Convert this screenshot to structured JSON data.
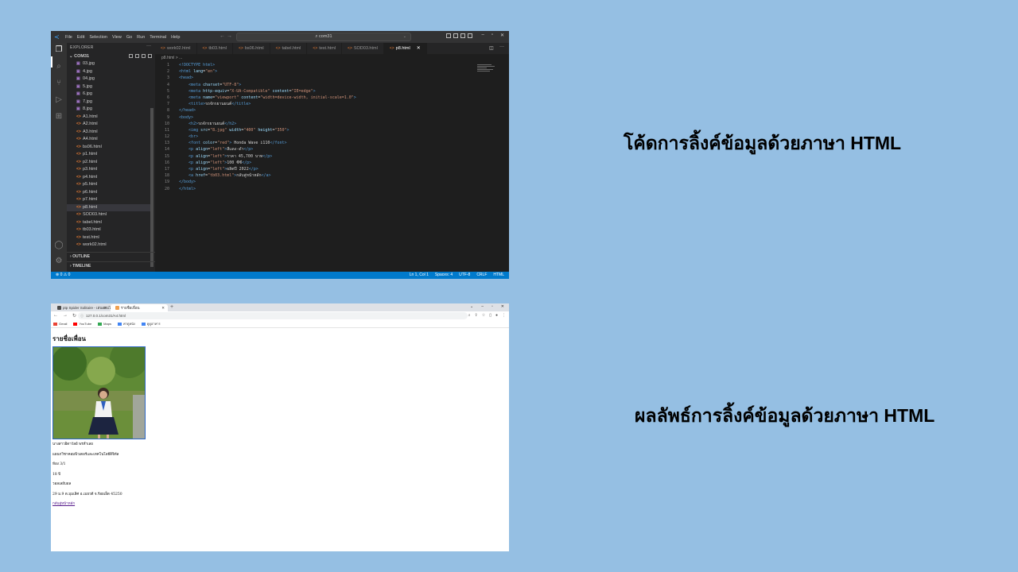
{
  "captions": {
    "code": "โค้ดการลิ้งค์ข้อมูลด้วยภาษา HTML",
    "result": "ผลลัพธ์การลิ้งค์ข้อมูลด้วยภาษา HTML"
  },
  "vscode": {
    "menu": [
      "File",
      "Edit",
      "Selection",
      "View",
      "Go",
      "Run",
      "Terminal",
      "Help"
    ],
    "search_text": "com31",
    "explorer_title": "EXPLORER",
    "folder_name": "COM31",
    "files": [
      {
        "name": "03.jpg",
        "type": "img"
      },
      {
        "name": "4.jpg",
        "type": "img"
      },
      {
        "name": "04.jpg",
        "type": "img"
      },
      {
        "name": "5.jpg",
        "type": "img"
      },
      {
        "name": "6.jpg",
        "type": "img"
      },
      {
        "name": "7.jpg",
        "type": "img"
      },
      {
        "name": "8.jpg",
        "type": "img"
      },
      {
        "name": "A1.html",
        "type": "html"
      },
      {
        "name": "A2.html",
        "type": "html"
      },
      {
        "name": "A3.html",
        "type": "html"
      },
      {
        "name": "A4.html",
        "type": "html"
      },
      {
        "name": "bs06.html",
        "type": "html"
      },
      {
        "name": "p1.html",
        "type": "html"
      },
      {
        "name": "p2.html",
        "type": "html"
      },
      {
        "name": "p3.html",
        "type": "html"
      },
      {
        "name": "p4.html",
        "type": "html"
      },
      {
        "name": "p5.html",
        "type": "html"
      },
      {
        "name": "p6.html",
        "type": "html"
      },
      {
        "name": "p7.html",
        "type": "html"
      },
      {
        "name": "p8.html",
        "type": "html"
      },
      {
        "name": "SOD03.html",
        "type": "html"
      },
      {
        "name": "tabel.html",
        "type": "html"
      },
      {
        "name": "tb03.html",
        "type": "html"
      },
      {
        "name": "test.html",
        "type": "html"
      },
      {
        "name": "work02.html",
        "type": "html"
      }
    ],
    "selected_file": "p8.html",
    "outline_label": "OUTLINE",
    "timeline_label": "TIMELINE",
    "tabs": [
      "work02.html",
      "tb03.html",
      "bs06.html",
      "tabel.html",
      "test.html",
      "SOD03.html",
      "p8.html"
    ],
    "active_tab": "p8.html",
    "breadcrumb": "p8.html > ...",
    "code_lines": [
      [
        [
          "c-tag",
          "<!DOCTYPE html>"
        ]
      ],
      [
        [
          "c-tag",
          "<html "
        ],
        [
          "c-attr",
          "lang"
        ],
        [
          "c-txt",
          "="
        ],
        [
          "c-str",
          "\"en\""
        ],
        [
          "c-tag",
          ">"
        ]
      ],
      [
        [
          "c-tag",
          "<head>"
        ]
      ],
      [
        [
          "c-txt",
          "    "
        ],
        [
          "c-tag",
          "<meta "
        ],
        [
          "c-attr",
          "charset"
        ],
        [
          "c-txt",
          "="
        ],
        [
          "c-str",
          "\"UTF-8\""
        ],
        [
          "c-tag",
          ">"
        ]
      ],
      [
        [
          "c-txt",
          "    "
        ],
        [
          "c-tag",
          "<meta "
        ],
        [
          "c-attr",
          "http-equiv"
        ],
        [
          "c-txt",
          "="
        ],
        [
          "c-str",
          "\"X-UA-Compatible\""
        ],
        [
          "c-txt",
          " "
        ],
        [
          "c-attr",
          "content"
        ],
        [
          "c-txt",
          "="
        ],
        [
          "c-str",
          "\"IE=edge\""
        ],
        [
          "c-tag",
          ">"
        ]
      ],
      [
        [
          "c-txt",
          "    "
        ],
        [
          "c-tag",
          "<meta "
        ],
        [
          "c-attr",
          "name"
        ],
        [
          "c-txt",
          "="
        ],
        [
          "c-str",
          "\"viewport\""
        ],
        [
          "c-txt",
          " "
        ],
        [
          "c-attr",
          "content"
        ],
        [
          "c-txt",
          "="
        ],
        [
          "c-str",
          "\"width=device-width, initial-scale=1.0\""
        ],
        [
          "c-tag",
          ">"
        ]
      ],
      [
        [
          "c-txt",
          "    "
        ],
        [
          "c-tag",
          "<title>"
        ],
        [
          "c-txt",
          "รถจักรยานยนต์"
        ],
        [
          "c-tag",
          "</title>"
        ]
      ],
      [
        [
          "c-tag",
          "</head>"
        ]
      ],
      [
        [
          "c-tag",
          "<body>"
        ]
      ],
      [
        [
          "c-txt",
          "    "
        ],
        [
          "c-tag",
          "<h2>"
        ],
        [
          "c-txt",
          "รถจักรยานยนต์"
        ],
        [
          "c-tag",
          "</h2>"
        ]
      ],
      [
        [
          "c-txt",
          "    "
        ],
        [
          "c-tag",
          "<img "
        ],
        [
          "c-attr",
          "src"
        ],
        [
          "c-txt",
          "="
        ],
        [
          "c-str",
          "\"8.jpg\""
        ],
        [
          "c-txt",
          " "
        ],
        [
          "c-attr",
          "width"
        ],
        [
          "c-txt",
          "="
        ],
        [
          "c-str",
          "\"400\""
        ],
        [
          "c-txt",
          " "
        ],
        [
          "c-attr",
          "height"
        ],
        [
          "c-txt",
          "="
        ],
        [
          "c-str",
          "\"350\""
        ],
        [
          "c-tag",
          ">"
        ]
      ],
      [
        [
          "c-txt",
          "    "
        ],
        [
          "c-tag",
          "<br>"
        ]
      ],
      [
        [
          "c-txt",
          "    "
        ],
        [
          "c-tag",
          "<font "
        ],
        [
          "c-attr",
          "color"
        ],
        [
          "c-txt",
          "="
        ],
        [
          "c-str",
          "\"red\""
        ],
        [
          "c-tag",
          ">"
        ],
        [
          "c-txt",
          " Honda Wave i110"
        ],
        [
          "c-tag",
          "</font>"
        ]
      ],
      [
        [
          "c-txt",
          "    "
        ],
        [
          "c-tag",
          "<p "
        ],
        [
          "c-attr",
          "align"
        ],
        [
          "c-txt",
          "="
        ],
        [
          "c-str",
          "\"left\""
        ],
        [
          "c-tag",
          ">"
        ],
        [
          "c-txt",
          "สีแดง-ดำ"
        ],
        [
          "c-tag",
          "</p>"
        ]
      ],
      [
        [
          "c-txt",
          "    "
        ],
        [
          "c-tag",
          "<p "
        ],
        [
          "c-attr",
          "align"
        ],
        [
          "c-txt",
          "="
        ],
        [
          "c-str",
          "\"left\""
        ],
        [
          "c-tag",
          ">"
        ],
        [
          "c-txt",
          "ราคา 45,700 บาท"
        ],
        [
          "c-tag",
          "</p>"
        ]
      ],
      [
        [
          "c-txt",
          "    "
        ],
        [
          "c-tag",
          "<p "
        ],
        [
          "c-attr",
          "align"
        ],
        [
          "c-txt",
          "="
        ],
        [
          "c-str",
          "\"left\""
        ],
        [
          "c-tag",
          ">"
        ],
        [
          "c-txt",
          "100 ซีซี"
        ],
        [
          "c-tag",
          "</p>"
        ]
      ],
      [
        [
          "c-txt",
          "    "
        ],
        [
          "c-tag",
          "<p "
        ],
        [
          "c-attr",
          "align"
        ],
        [
          "c-txt",
          "="
        ],
        [
          "c-str",
          "\"left\""
        ],
        [
          "c-tag",
          ">"
        ],
        [
          "c-txt",
          "ผลิตปี 2022"
        ],
        [
          "c-tag",
          "</p>"
        ]
      ],
      [
        [
          "c-txt",
          "    "
        ],
        [
          "c-tag",
          "<a "
        ],
        [
          "c-attr",
          "href"
        ],
        [
          "c-txt",
          "="
        ],
        [
          "c-str",
          "\"tb03.html\""
        ],
        [
          "c-tag",
          ">"
        ],
        [
          "c-txt",
          "กลับสู่หน้าหลัก"
        ],
        [
          "c-tag",
          "</a>"
        ]
      ],
      [
        [
          "c-tag",
          "</body>"
        ]
      ],
      [
        [
          "c-tag",
          "</html>"
        ]
      ]
    ],
    "status_left": "⊗ 0 ⚠ 0",
    "status_right": [
      "Ln 1, Col 1",
      "Spaces: 4",
      "UTF-8",
      "CRLF",
      "HTML"
    ]
  },
  "browser": {
    "tabs": [
      {
        "label": "ptp Spider Solitaire - เล่นออนไลน์",
        "active": false
      },
      {
        "label": "รายชื่อเพื่อน",
        "active": true
      }
    ],
    "url": "127.0.0.1/com31/A4.html",
    "bookmarks": [
      "Gmail",
      "YouTube",
      "Maps",
      "ค่าดูหนัง",
      "ดูดูอาหาร"
    ],
    "page": {
      "heading": "รายชื่อเพื่อน",
      "lines": [
        "นางสาวอิดาวัลย์ พรหำเลย",
        "แผนกวิชาคอมพิวเตอร์และเทคโนโลยีดิจิทัล",
        "ห้อง 3/1",
        "18 ปี",
        "วอลเลย์บอล",
        "29 ม.9 ต.มุมเลิศ อ.เมยวดี จ.ร้อยเอ็ด 45250"
      ],
      "link": "กลับสู่หน้าหลัก"
    }
  }
}
